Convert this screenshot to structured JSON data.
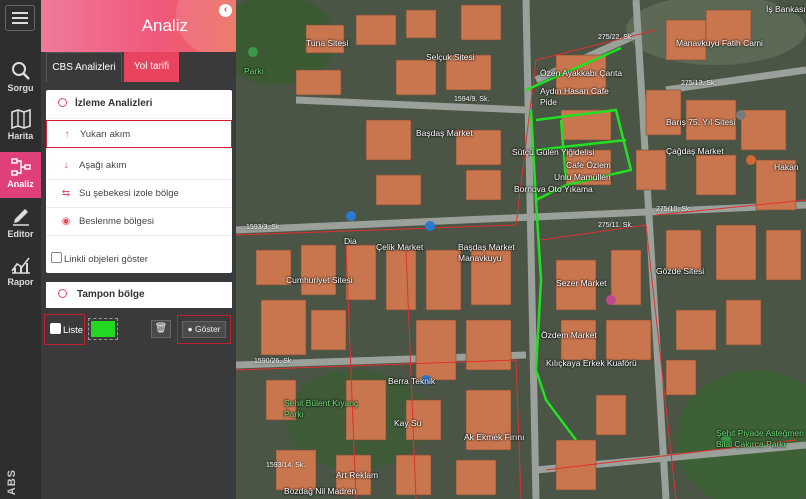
{
  "panel": {
    "title": "Analiz",
    "tabs": [
      {
        "label": "CBS Analizleri"
      },
      {
        "label": "Yol tarifi"
      }
    ]
  },
  "rail": {
    "items": [
      {
        "label": "Sorgu",
        "icon": "search-icon"
      },
      {
        "label": "Harita",
        "icon": "map-icon"
      },
      {
        "label": "Analiz",
        "icon": "network-icon"
      },
      {
        "label": "Editor",
        "icon": "pencil-icon"
      },
      {
        "label": "Rapor",
        "icon": "chart-icon"
      }
    ],
    "brand": "ABS"
  },
  "izleme": {
    "heading": "İzleme Analizleri",
    "items": [
      {
        "label": "Yukarı akım",
        "icon": "arrow-up-icon"
      },
      {
        "label": "Aşağı akım",
        "icon": "arrow-down-icon"
      },
      {
        "label": "Su şebekesi izole bölge",
        "icon": "swap-icon"
      },
      {
        "label": "Beslenme bölgesi",
        "icon": "target-icon"
      }
    ],
    "linked_label": "Linkli objeleri göster"
  },
  "tampon": {
    "heading": "Tampon bölge"
  },
  "controls": {
    "liste_label": "Liste",
    "goster_label": "Göster",
    "swatch_color": "#22d822"
  },
  "map": {
    "places": [
      {
        "text": "Tuna Sitesi"
      },
      {
        "text": "Selçuk Sitesi"
      },
      {
        "text": "Başdaş Market"
      },
      {
        "text": "Sütçü Gülen Yiğidelisi"
      },
      {
        "text": "Cafe Özlem"
      },
      {
        "text": "Bornova Oto Yıkama"
      },
      {
        "text": "Çağdaş Market"
      },
      {
        "text": "Barış 75. Yıl Sitesi"
      },
      {
        "text": "Manavkuyu Fatih Cami"
      },
      {
        "text": "Cumhuriyet Sitesi"
      },
      {
        "text": "Çelik Market"
      },
      {
        "text": "Başdaş Market Manavkuyu"
      },
      {
        "text": "Sezer Market"
      },
      {
        "text": "Gözde Sitesi"
      },
      {
        "text": "Özdem Market"
      },
      {
        "text": "Kılıçkaya Erkek Kuaförü"
      },
      {
        "text": "Berra Teknik"
      },
      {
        "text": "Şehit Bülent Kıyanç Parkı"
      },
      {
        "text": "Kay Su"
      },
      {
        "text": "Ak Ekmek Fırını"
      },
      {
        "text": "Art Reklam"
      },
      {
        "text": "Bozdağ Nil Madren"
      },
      {
        "text": "Hakan"
      },
      {
        "text": "Şehit Piyade Asteğmen Bilal Çakırca Parkı"
      },
      {
        "text": "Özen Ayakkabı Çanta"
      },
      {
        "text": "Aydın Hasan Cafe Pide"
      },
      {
        "text": "Unlu Mamülleri"
      },
      {
        "text": "Dia"
      },
      {
        "text": "Parkı"
      },
      {
        "text": "İş Bankası"
      }
    ],
    "roads": [
      {
        "text": "1594/9. Sk."
      },
      {
        "text": "1593/3. Sk."
      },
      {
        "text": "275/11. Sk."
      },
      {
        "text": "275/13. Sk."
      },
      {
        "text": "275/22. Sk."
      },
      {
        "text": "1590/26. Sk."
      },
      {
        "text": "275/10. Sk."
      },
      {
        "text": "1593/14. Sk."
      }
    ]
  }
}
